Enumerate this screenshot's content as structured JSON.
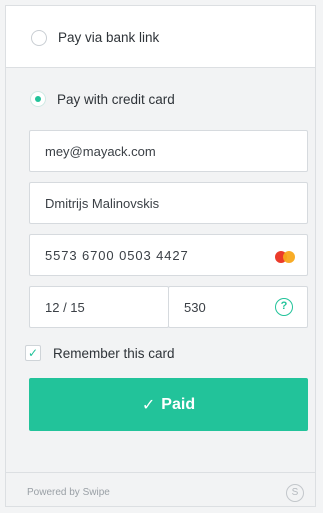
{
  "payment_options": {
    "bank": {
      "label": "Pay via bank link",
      "selected": false
    },
    "card": {
      "label": "Pay with credit card",
      "selected": true
    }
  },
  "form": {
    "email": "mey@mayack.com",
    "name": "Dmitrijs Malinovskis",
    "card_number": "5573  6700  0503  4427",
    "expiry": "12  /  15",
    "cvc": "530",
    "help_glyph": "?",
    "remember_label": "Remember this card",
    "remember_checked": true,
    "card_brand_icon": "mastercard-icon"
  },
  "pay_button": {
    "check_glyph": "✓",
    "label": "Paid"
  },
  "footer": {
    "powered_by": "Powered by Swipe",
    "logo_glyph": "S"
  },
  "colors": {
    "accent": "#22c39a",
    "background": "#f3f4f5"
  }
}
